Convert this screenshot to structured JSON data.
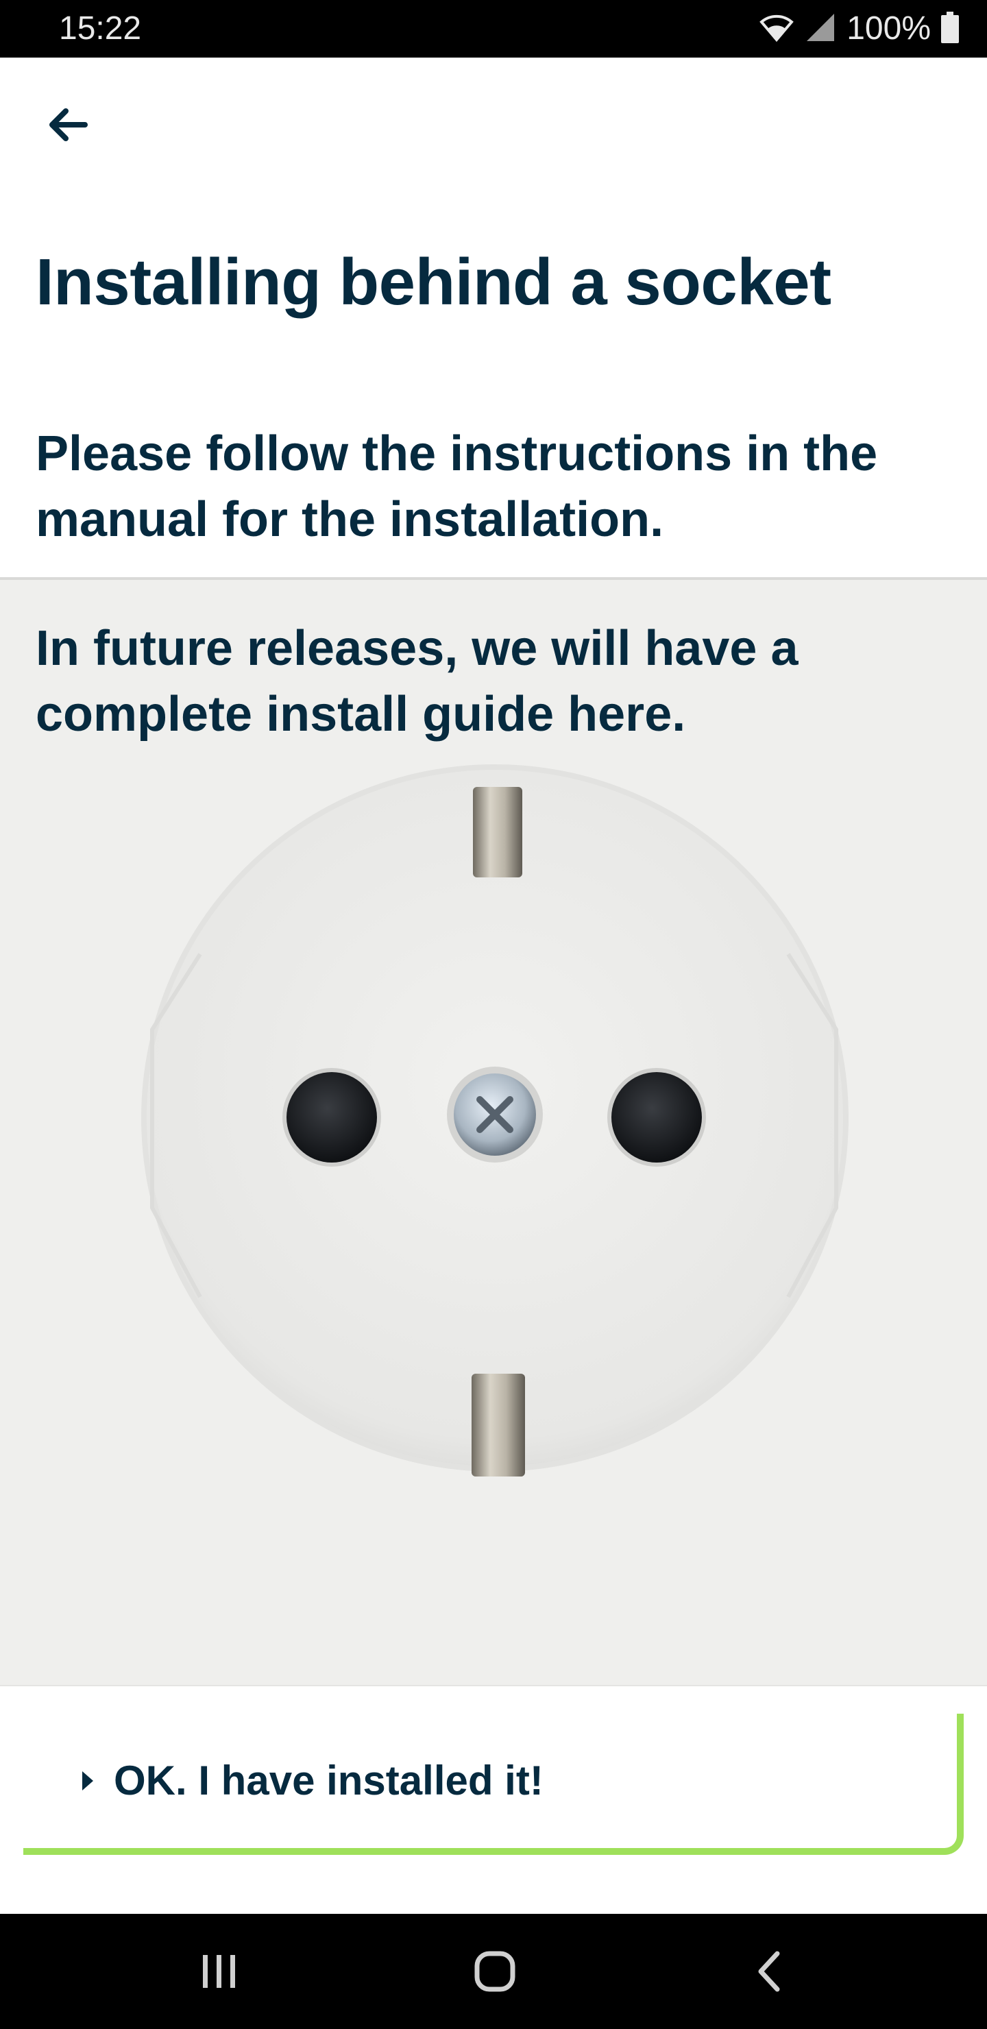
{
  "status_bar": {
    "time": "15:22",
    "battery": "100%",
    "icons": [
      "wifi-icon",
      "cell-signal-icon",
      "battery-icon"
    ]
  },
  "header": {
    "back_icon": "arrow-left-icon",
    "title": "Installing behind a socket"
  },
  "content": {
    "intro": "Please follow the instructions in the manual for the installation.",
    "future_note": "In future releases, we will have a complete install guide here.",
    "image": "power-socket-image"
  },
  "action": {
    "label": "OK. I have installed it!",
    "accent_color": "#9fe05a"
  },
  "nav_bar": {
    "icons": [
      "recent-apps-icon",
      "home-icon",
      "back-nav-icon"
    ]
  },
  "colors": {
    "text": "#062a3f",
    "accent": "#9fe05a",
    "image_bg": "#efefed"
  }
}
